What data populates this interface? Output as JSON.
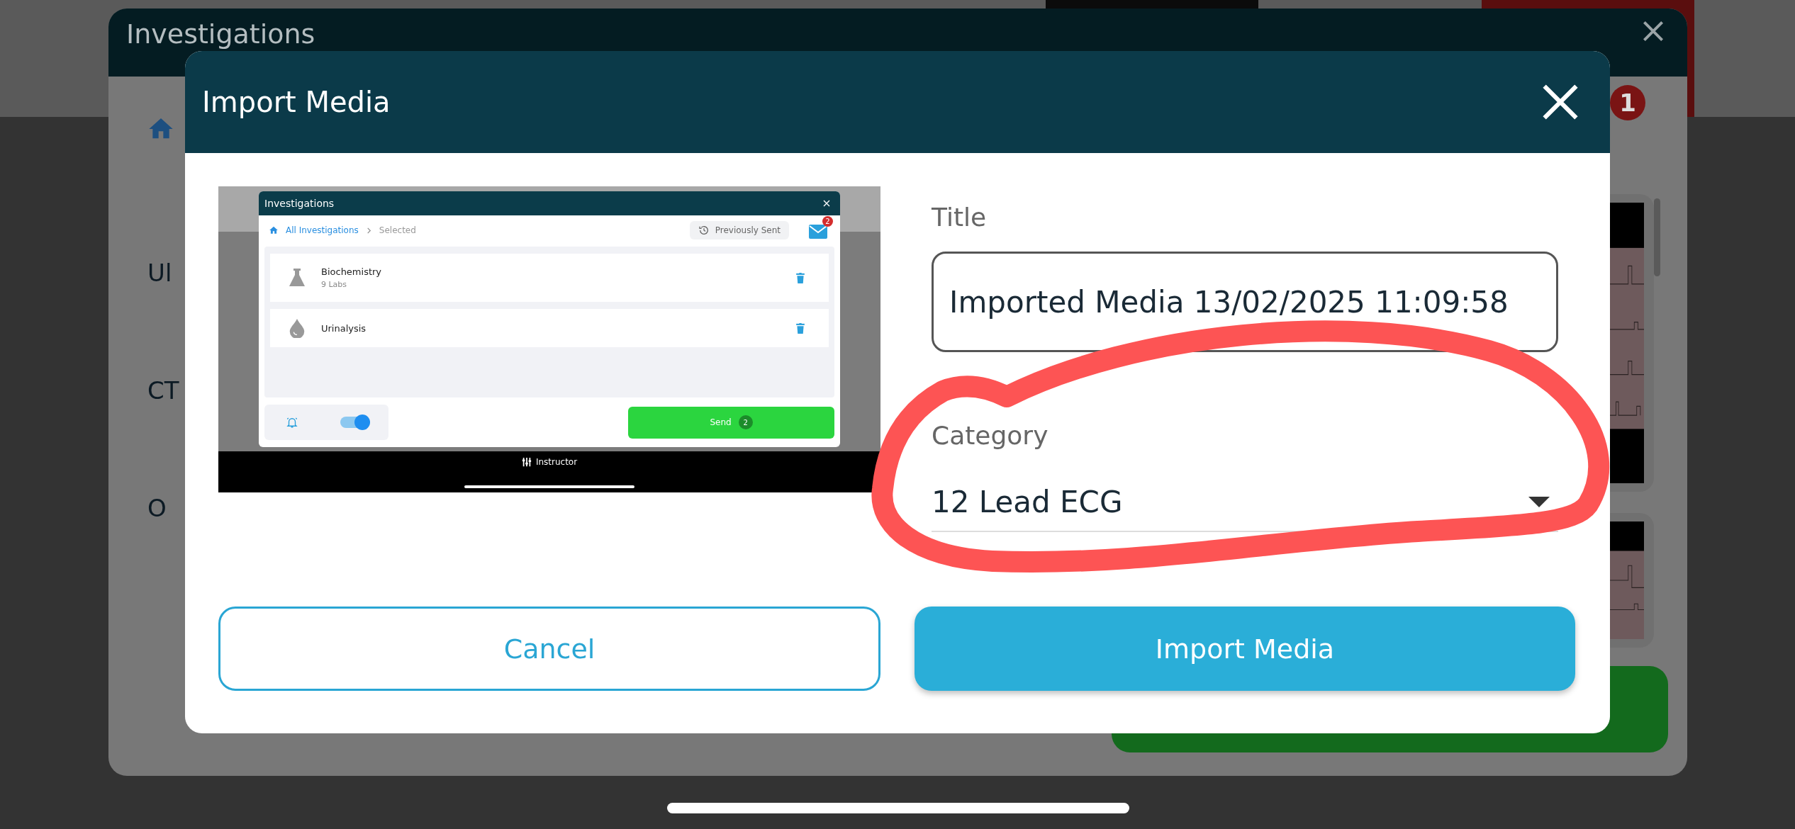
{
  "background_window": {
    "title": "Investigations",
    "badge": "1",
    "list_items": [
      "Ul",
      "CT",
      "O"
    ]
  },
  "dialog": {
    "title": "Import Media",
    "preview": {
      "window_title": "Investigations",
      "breadcrumbs": [
        {
          "label": "All Investigations",
          "selected": false
        },
        {
          "label": "Selected",
          "selected": true
        }
      ],
      "previously_sent": "Previously Sent",
      "mail_badge": "2",
      "items": [
        {
          "name": "Biochemistry",
          "detail": "9 Labs",
          "kind": "flask"
        },
        {
          "name": "Urinalysis",
          "kind": "drop"
        }
      ],
      "alarm_toggle": {
        "on": true
      },
      "send": {
        "label": "Send",
        "count": "2"
      },
      "bottom_bar": "Instructor"
    },
    "fields": [
      {
        "label": "Title",
        "value": "Imported Media 13/02/2025 11:09:58",
        "kind": "text"
      },
      {
        "label": "Category",
        "value": "12 Lead ECG",
        "kind": "select"
      }
    ],
    "buttons": [
      {
        "label": "Cancel",
        "kind": "secondary"
      },
      {
        "label": "Import Media",
        "kind": "primary"
      }
    ]
  }
}
